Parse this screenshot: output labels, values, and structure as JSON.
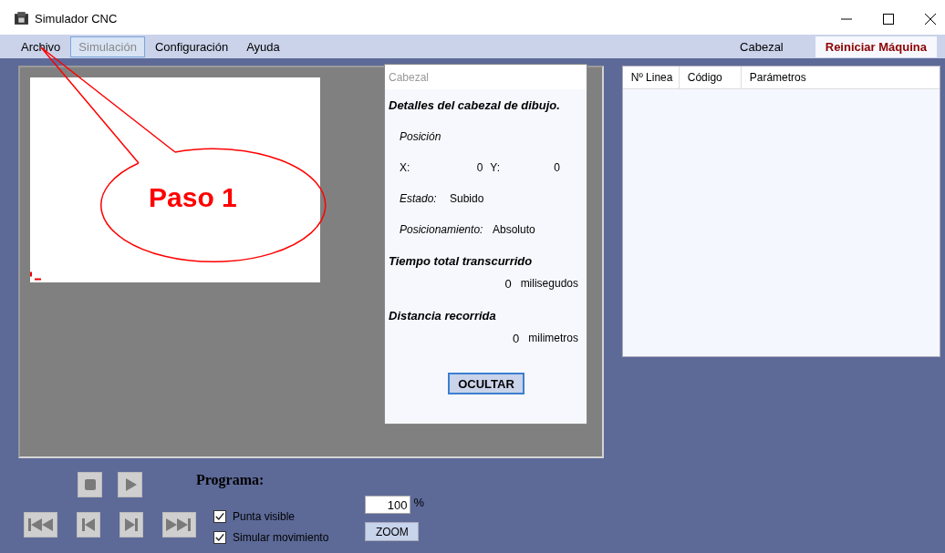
{
  "window": {
    "title": "Simulador CNC"
  },
  "menu": {
    "items": [
      {
        "label": "Archivo",
        "selected": false,
        "disabled": false
      },
      {
        "label": "Simulación",
        "selected": true,
        "disabled": true
      },
      {
        "label": "Configuración",
        "selected": false,
        "disabled": false
      },
      {
        "label": "Ayuda",
        "selected": false,
        "disabled": false
      }
    ],
    "right_items": [
      {
        "label": "Cabezal",
        "kind": "plain"
      },
      {
        "label": "Reiniciar Máquina",
        "kind": "highlight"
      }
    ]
  },
  "cabezal_panel": {
    "title": "Cabezal",
    "heading": "Detalles del cabezal de dibujo.",
    "position_label": "Posición",
    "x_label": "X:",
    "x_value": "0",
    "y_label": "Y:",
    "y_value": "0",
    "estado_label": "Estado:",
    "estado_value": "Subido",
    "posicionamiento_label": "Posicionamiento:",
    "posicionamiento_value": "Absoluto",
    "tiempo_heading": "Tiempo total transcurrido",
    "tiempo_value": "0",
    "tiempo_unit": "milisegudos",
    "distancia_heading": "Distancia recorrida",
    "distancia_value": "0",
    "distancia_unit": "milimetros",
    "button": "OCULTAR"
  },
  "table": {
    "columns": [
      "Nº Linea",
      "Código",
      "Parámetros"
    ]
  },
  "program": {
    "title": "Programa:",
    "options": [
      {
        "label": "Punta visible",
        "checked": true
      },
      {
        "label": "Simular movimiento",
        "checked": true
      }
    ],
    "zoom_value": "100",
    "zoom_unit": "%",
    "zoom_button": "ZOOM"
  },
  "annotation": {
    "text": "Paso 1"
  }
}
